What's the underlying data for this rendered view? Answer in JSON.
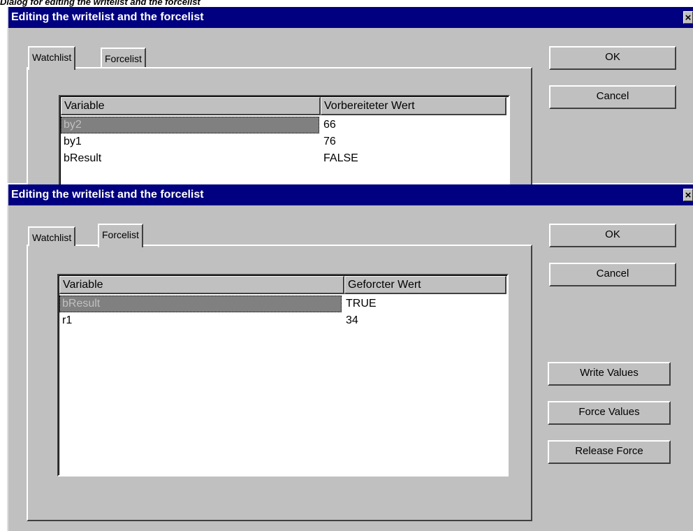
{
  "caption": "Dialog for editing the writelist and the forcelist",
  "dialog1": {
    "title": "Editing the writelist and the forcelist",
    "close_label": "×",
    "tabs": [
      "Watchlist",
      "Forcelist"
    ],
    "columns": [
      "Variable",
      "Vorbereiteter Wert"
    ],
    "rows": [
      {
        "variable": "by2",
        "value": "66",
        "selected": true
      },
      {
        "variable": "by1",
        "value": "76"
      },
      {
        "variable": "bResult",
        "value": "FALSE"
      }
    ],
    "buttons": {
      "ok": "OK",
      "cancel": "Cancel"
    }
  },
  "dialog2": {
    "title": "Editing the writelist and the forcelist",
    "close_label": "×",
    "tabs": [
      "Watchlist",
      "Forcelist"
    ],
    "columns": [
      "Variable",
      "Geforcter Wert"
    ],
    "rows": [
      {
        "variable": "bResult",
        "value": "TRUE",
        "selected": true
      },
      {
        "variable": "r1",
        "value": "34"
      }
    ],
    "buttons": {
      "ok": "OK",
      "cancel": "Cancel",
      "write_values": "Write Values",
      "force_values": "Force Values",
      "release_force": "Release Force"
    }
  }
}
